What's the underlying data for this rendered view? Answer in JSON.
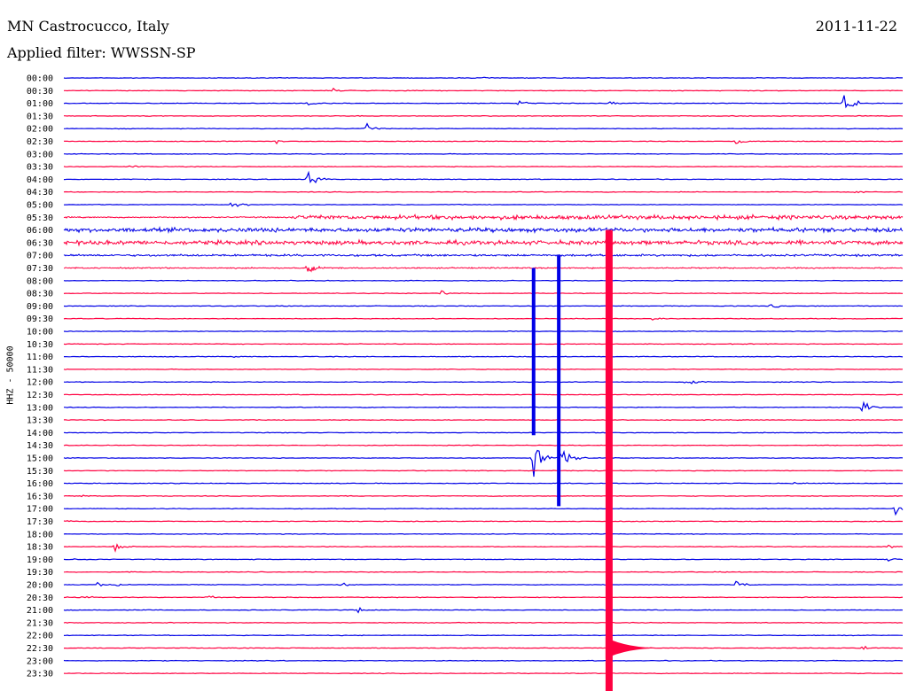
{
  "header": {
    "station": "MN Castrocucco, Italy",
    "date": "2011-11-22",
    "filter": "Applied filter: WWSSN-SP"
  },
  "colors": {
    "even_hour": "#0000e6",
    "half_hour": "#ff0040"
  },
  "chart_data": {
    "type": "line",
    "title": "MN Castrocucco, Italy",
    "ylabel": "HHZ - 50000",
    "row_labels": [
      "00:00",
      "00:30",
      "01:00",
      "01:30",
      "02:00",
      "02:30",
      "03:00",
      "03:30",
      "04:00",
      "04:30",
      "05:00",
      "05:30",
      "06:00",
      "06:30",
      "07:00",
      "07:30",
      "08:00",
      "08:30",
      "09:00",
      "09:30",
      "10:00",
      "10:30",
      "11:00",
      "11:30",
      "12:00",
      "12:30",
      "13:00",
      "13:30",
      "14:00",
      "14:30",
      "15:00",
      "15:30",
      "16:00",
      "16:30",
      "17:00",
      "17:30",
      "18:00",
      "18:30",
      "19:00",
      "19:30",
      "20:00",
      "20:30",
      "21:00",
      "21:30",
      "22:00",
      "22:30",
      "23:00",
      "23:30"
    ],
    "noisy_rows": [
      "05:30",
      "06:00",
      "06:30",
      "07:00",
      "07:30"
    ],
    "events": [
      {
        "row": "00:00",
        "t": 0.5,
        "amp": 0.2
      },
      {
        "row": "00:30",
        "t": 0.32,
        "amp": 0.4
      },
      {
        "row": "01:00",
        "t": 0.29,
        "amp": 0.5
      },
      {
        "row": "01:00",
        "t": 0.54,
        "amp": 0.6
      },
      {
        "row": "01:00",
        "t": 0.65,
        "amp": 0.3
      },
      {
        "row": "01:00",
        "t": 0.93,
        "amp": 2.5
      },
      {
        "row": "02:00",
        "t": 0.36,
        "amp": 0.8
      },
      {
        "row": "02:30",
        "t": 0.25,
        "amp": 0.5
      },
      {
        "row": "02:30",
        "t": 0.8,
        "amp": 1.0
      },
      {
        "row": "03:30",
        "t": 0.08,
        "amp": 0.4
      },
      {
        "row": "04:00",
        "t": 0.29,
        "amp": 2.2
      },
      {
        "row": "04:30",
        "t": 0.94,
        "amp": 0.4
      },
      {
        "row": "05:00",
        "t": 0.2,
        "amp": 1.0
      },
      {
        "row": "07:30",
        "t": 0.29,
        "amp": 1.2
      },
      {
        "row": "08:30",
        "t": 0.45,
        "amp": 0.7
      },
      {
        "row": "09:00",
        "t": 0.84,
        "amp": 0.6
      },
      {
        "row": "09:30",
        "t": 0.7,
        "amp": 0.4
      },
      {
        "row": "11:00",
        "t": 0.2,
        "amp": 0.3
      },
      {
        "row": "12:00",
        "t": 0.74,
        "amp": 1.4
      },
      {
        "row": "13:00",
        "t": 0.95,
        "amp": 1.6
      },
      {
        "row": "15:00",
        "t": 0.56,
        "amp": 3.5
      },
      {
        "row": "15:00",
        "t": 0.59,
        "amp": 5.0
      },
      {
        "row": "16:00",
        "t": 0.87,
        "amp": 0.3
      },
      {
        "row": "16:30",
        "t": 0.02,
        "amp": 0.4
      },
      {
        "row": "17:00",
        "t": 0.99,
        "amp": 1.0
      },
      {
        "row": "17:30",
        "t": 0.0,
        "amp": 0.4
      },
      {
        "row": "18:30",
        "t": 0.06,
        "amp": 1.2
      },
      {
        "row": "18:30",
        "t": 0.98,
        "amp": 0.4
      },
      {
        "row": "19:00",
        "t": 0.01,
        "amp": 0.4
      },
      {
        "row": "19:00",
        "t": 0.98,
        "amp": 0.6
      },
      {
        "row": "20:00",
        "t": 0.04,
        "amp": 0.4
      },
      {
        "row": "20:00",
        "t": 0.06,
        "amp": 0.4
      },
      {
        "row": "20:00",
        "t": 0.33,
        "amp": 0.5
      },
      {
        "row": "20:00",
        "t": 0.8,
        "amp": 1.2
      },
      {
        "row": "20:30",
        "t": 0.02,
        "amp": 0.8
      },
      {
        "row": "20:30",
        "t": 0.17,
        "amp": 0.4
      },
      {
        "row": "21:00",
        "t": 0.35,
        "amp": 0.5
      },
      {
        "row": "22:30",
        "t": 0.95,
        "amp": 0.4
      }
    ],
    "big_quake": {
      "row": "22:30",
      "t": 0.65
    },
    "grid": false,
    "legend": "none"
  }
}
